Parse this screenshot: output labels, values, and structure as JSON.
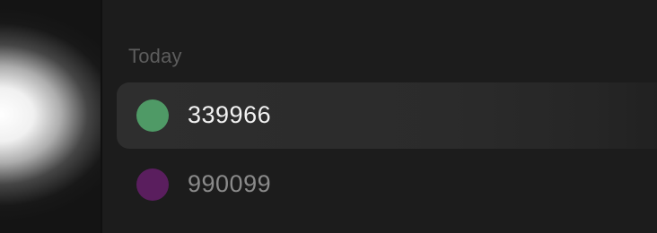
{
  "section": {
    "title": "Today"
  },
  "colors": {
    "selected_row_bg": "#2d2d2d",
    "panel_bg": "#1c1c1c"
  },
  "items": [
    {
      "label": "339966",
      "swatch_color": "#4f9a66",
      "selected": true
    },
    {
      "label": "990099",
      "swatch_color": "#5a1e5e",
      "selected": false
    }
  ]
}
